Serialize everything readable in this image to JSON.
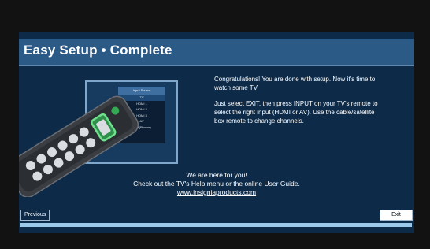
{
  "header": {
    "title": "Easy Setup • Complete"
  },
  "tv_menu": {
    "header": "Input Source",
    "items": [
      "TV",
      "HDMI 1",
      "HDMI 2",
      "HDMI 3",
      "AV",
      "USB(Photos)"
    ],
    "selected_index": 0
  },
  "message": {
    "line1": "Congratulations! You are done with setup. Now it's time to watch some TV.",
    "line2": "Just select EXIT, then press INPUT on your TV's remote to select the right input (HDMI or AV). Use the cable/satellite box remote to change channels."
  },
  "support": {
    "line1": "We are here for you!",
    "line2": "Check out the TV's Help menu or the online User Guide.",
    "link": "www.insigniaproducts.com"
  },
  "buttons": {
    "previous": "Previous",
    "exit": "Exit"
  },
  "progress": {
    "fraction": 1.0
  },
  "colors": {
    "background": "#0d2b49",
    "title_bar": "#2c5a86",
    "progress": "#4f83b6",
    "exit_button": "#ffffff"
  }
}
